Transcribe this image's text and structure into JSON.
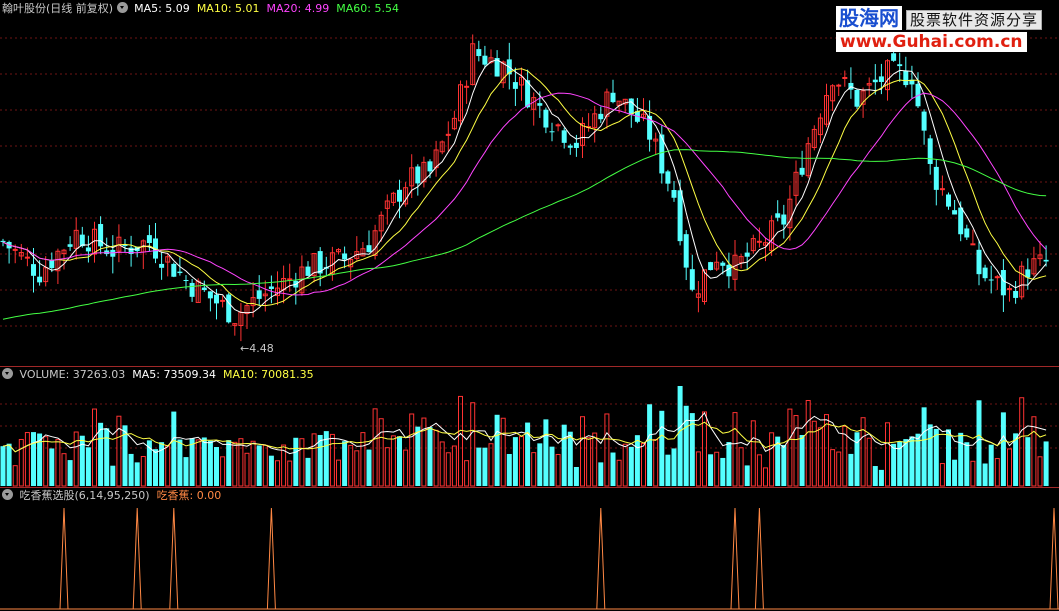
{
  "price_panel": {
    "stock_title": "翰叶股份(日线 前复权)",
    "ma_labels": [
      {
        "text": "MA5: 5.09",
        "color": "#ffffff"
      },
      {
        "text": "MA10: 5.01",
        "color": "#ffff44"
      },
      {
        "text": "MA20: 4.99",
        "color": "#ff44ff"
      },
      {
        "text": "MA60: 5.54",
        "color": "#44ff44"
      }
    ],
    "low_marker": "4.48"
  },
  "volume_panel": {
    "title": "VOLUME: 37263.03",
    "ma_labels": [
      {
        "text": "MA5: 73509.34",
        "color": "#ffffff"
      },
      {
        "text": "MA10: 70081.35",
        "color": "#ffff44"
      }
    ]
  },
  "indicator_panel": {
    "title": "吃香蕉选股(6,14,95,250)",
    "value_label": "吃香蕉: 0.00",
    "value_color": "#ff8844"
  },
  "watermark": {
    "brand": "股海网",
    "slogan": "股票软件资源分享",
    "url": "www.Guhai.com.cn"
  },
  "colors": {
    "up": "#ff3232",
    "down": "#54ffff",
    "grid": "#6e1414",
    "divider": "#a02828",
    "ma5": "#ffffff",
    "ma10": "#ffff44",
    "ma20": "#ff44ff",
    "ma60": "#44ff44",
    "signal": "#ff8844"
  },
  "chart_data": [
    {
      "type": "candlestick",
      "name": "price",
      "ma_lines": [
        "MA5",
        "MA10",
        "MA20",
        "MA60"
      ],
      "annotations": [
        {
          "text": "4.48",
          "type": "low-marker"
        }
      ]
    },
    {
      "type": "bar",
      "name": "volume",
      "ma_lines": [
        "MA5",
        "MA10"
      ]
    },
    {
      "type": "line",
      "name": "吃香蕉",
      "signal_count": 9,
      "current_value": 0.0
    }
  ]
}
